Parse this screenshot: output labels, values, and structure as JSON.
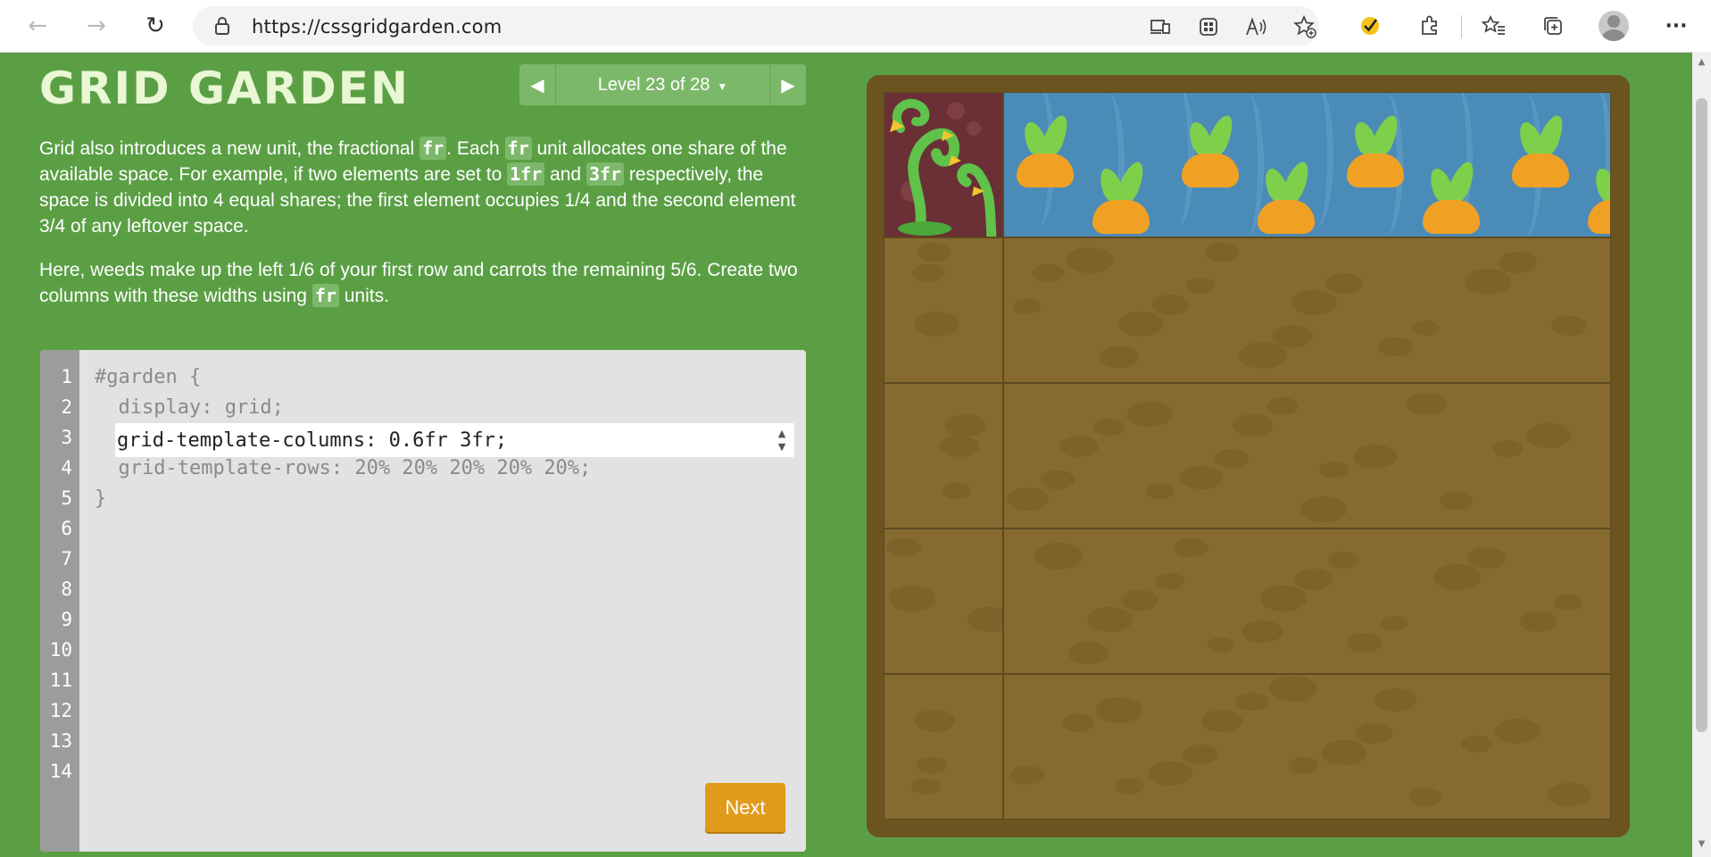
{
  "browser": {
    "url": "https://cssgridgarden.com",
    "back_icon": "←",
    "forward_icon": "→",
    "refresh_icon": "↻",
    "more_icon": "···"
  },
  "header": {
    "title": "GRID GARDEN",
    "level_label": "Level 23 of 28",
    "level_caret": "▼",
    "prev_arrow": "◀",
    "next_arrow": "▶"
  },
  "instructions": {
    "p1": [
      {
        "t": "Grid also introduces a new unit, the fractional "
      },
      {
        "c": "fr"
      },
      {
        "t": ". Each "
      },
      {
        "c": "fr"
      },
      {
        "t": " unit allocates one share of the available space. For example, if two elements are set to "
      },
      {
        "c": "1fr"
      },
      {
        "t": " and "
      },
      {
        "c": "3fr"
      },
      {
        "t": " respectively, the space is divided into 4 equal shares; the first element occupies 1/4 and the second element 3/4 of any leftover space."
      }
    ],
    "p2": [
      {
        "t": "Here, weeds make up the left 1/6 of your first row and carrots the remaining 5/6. Create two columns with these widths using "
      },
      {
        "c": "fr"
      },
      {
        "t": " units."
      }
    ]
  },
  "editor": {
    "line_numbers": [
      "1",
      "2",
      "3",
      "4",
      "5",
      "6",
      "7",
      "8",
      "9",
      "10",
      "11",
      "12",
      "13",
      "14"
    ],
    "line1": "#garden {",
    "line2": "  display: grid;",
    "line3_value": "grid-template-columns: 0.6fr 3fr;",
    "line4": "  grid-template-rows: 20% 20% 20% 20% 20%;",
    "line5": "}",
    "next_label": "Next"
  },
  "colors": {
    "page_bg": "#5b9f45",
    "next_button": "#e09b1b",
    "soil": "#866a30",
    "weed": "#6b2f36",
    "water": "#4b8bb8",
    "carrot": "#f0a123"
  }
}
